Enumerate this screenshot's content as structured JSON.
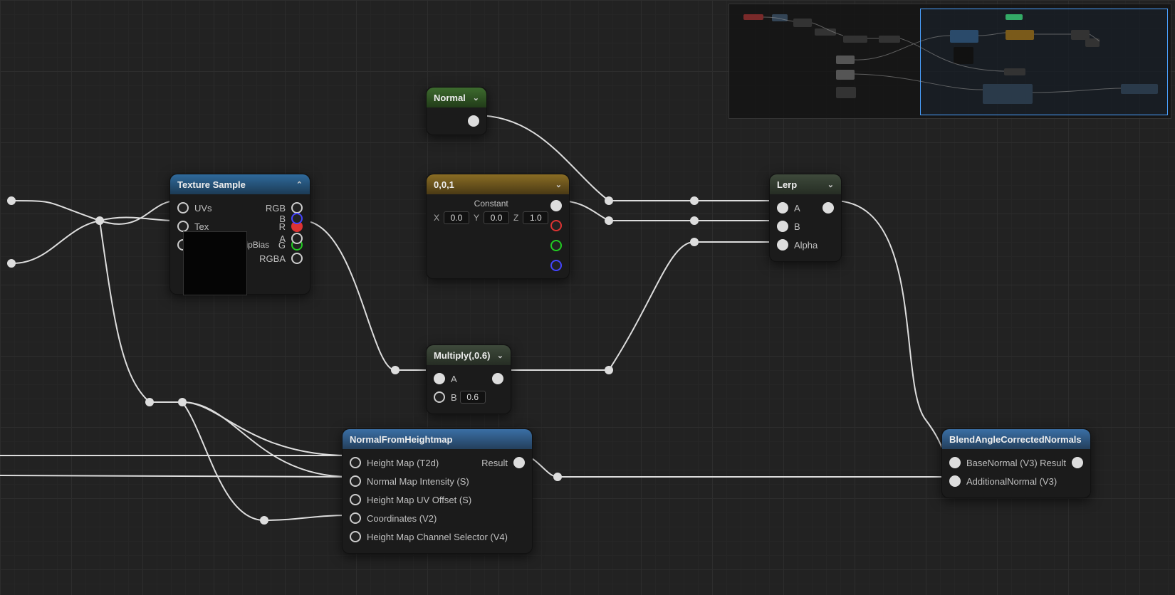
{
  "nodes": {
    "texture_sample": {
      "title": "Texture Sample",
      "inputs": [
        "UVs",
        "Tex",
        "Apply View MipBias"
      ],
      "outputs": [
        "RGB",
        "R",
        "G",
        "B",
        "A",
        "RGBA"
      ]
    },
    "normal": {
      "title": "Normal"
    },
    "constant3": {
      "title": "0,0,1",
      "label": "Constant",
      "x_prefix": "X",
      "x": "0.0",
      "y_prefix": "Y",
      "y": "0.0",
      "z_prefix": "Z",
      "z": "1.0"
    },
    "multiply": {
      "title": "Multiply(,0.6)",
      "a": "A",
      "b": "B",
      "b_val": "0.6"
    },
    "lerp": {
      "title": "Lerp",
      "a": "A",
      "b": "B",
      "alpha": "Alpha"
    },
    "normal_from_heightmap": {
      "title": "NormalFromHeightmap",
      "inputs": [
        "Height Map (T2d)",
        "Normal Map Intensity (S)",
        "Height Map UV Offset (S)",
        "Coordinates (V2)",
        "Height Map Channel Selector (V4)"
      ],
      "output": "Result"
    },
    "blend_normals": {
      "title": "BlendAngleCorrectedNormals",
      "inputs": [
        "BaseNormal (V3)",
        "AdditionalNormal (V3)"
      ],
      "output": "Result"
    }
  }
}
